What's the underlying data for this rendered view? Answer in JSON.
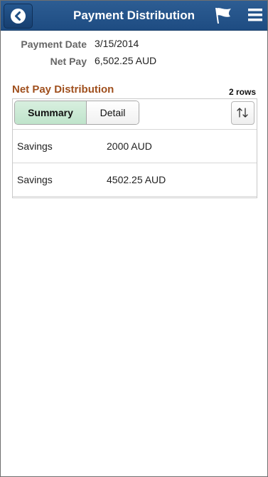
{
  "header": {
    "title": "Payment Distribution",
    "back_icon": "chevron-left-icon",
    "flag_icon": "flag-icon",
    "menu_icon": "hamburger-menu-icon"
  },
  "summary": {
    "payment_date_label": "Payment Date",
    "payment_date_value": "3/15/2014",
    "net_pay_label": "Net Pay",
    "net_pay_value": "6,502.25 AUD"
  },
  "distribution": {
    "title": "Net Pay Distribution",
    "row_count": "2 rows",
    "tabs": [
      {
        "label": "Summary",
        "selected": true
      },
      {
        "label": "Detail",
        "selected": false
      }
    ],
    "sort_icon": "sort-icon",
    "rows": [
      {
        "type": "Savings",
        "amount": "2000 AUD"
      },
      {
        "type": "Savings",
        "amount": "4502.25 AUD"
      }
    ]
  },
  "colors": {
    "header_bg": "#1e4c82",
    "section_title": "#a0501e",
    "selected_tab": "#c8e8d2"
  }
}
